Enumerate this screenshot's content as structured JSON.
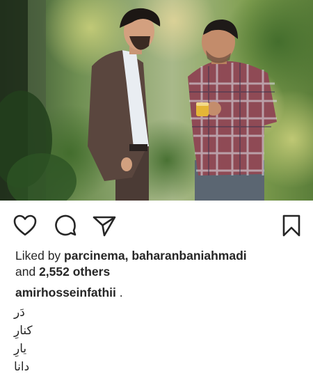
{
  "post": {
    "likes": {
      "prefix": "Liked by ",
      "user1": "parcinema",
      "separator": ", ",
      "user2": "baharanbaniahmadi",
      "and_text": "and ",
      "others_count": "2,552 others"
    },
    "caption": {
      "username": "amirhosseinfathii",
      "text": " .",
      "lines": [
        "دَر",
        "کنارِ",
        "یارِ",
        "دانا"
      ]
    }
  },
  "icons": {
    "like": "heart-icon",
    "comment": "speech-bubble-icon",
    "share": "paper-plane-icon",
    "save": "bookmark-icon"
  },
  "colors": {
    "text": "#262626",
    "icon": "#262626",
    "background": "#ffffff"
  }
}
